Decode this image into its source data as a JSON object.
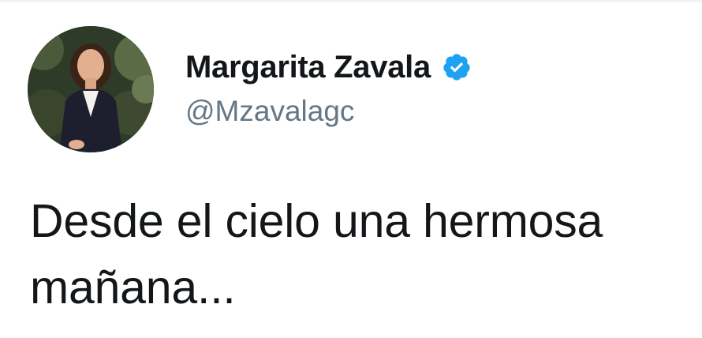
{
  "author": {
    "display_name": "Margarita Zavala",
    "handle": "@Mzavalagc",
    "verified_icon": "verified-badge-icon",
    "verified_color": "#1da1f2"
  },
  "tweet": {
    "text": "Desde el cielo una hermosa mañana..."
  },
  "colors": {
    "name": "#14171a",
    "handle": "#657786",
    "text": "#14171a",
    "background": "#ffffff"
  }
}
